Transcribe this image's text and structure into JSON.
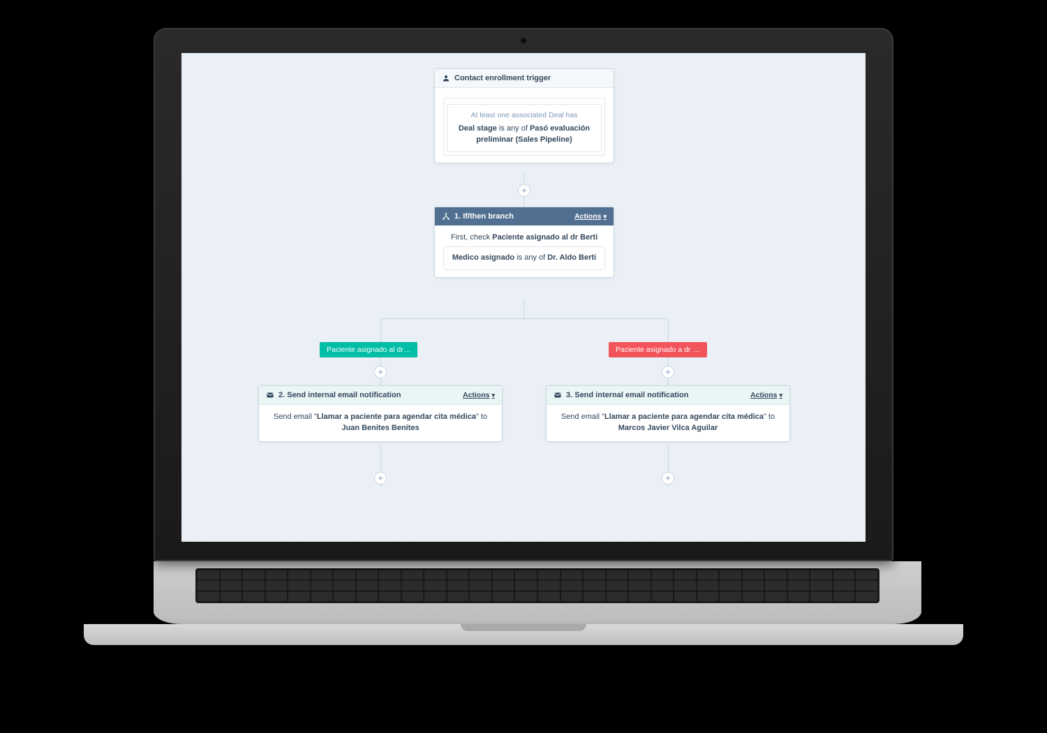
{
  "trigger": {
    "title": "Contact enrollment trigger",
    "hint": "At least one associated Deal has",
    "criteria_prefix": "Deal stage",
    "criteria_mid": " is any of ",
    "criteria_value": "Pasó evaluación preliminar (Sales Pipeline)"
  },
  "branch": {
    "title": "1. If/then branch",
    "actions_label": "Actions",
    "check_prefix": "First, check ",
    "check_target": "Paciente asignado al dr Berti",
    "criteria_prefix": "Medico asignado",
    "criteria_mid": " is any of ",
    "criteria_value": "Dr. Aldo Berti"
  },
  "branches": {
    "left_label": "Paciente asignado al dr…",
    "right_label": "Paciente asignado a dr …"
  },
  "action_left": {
    "title": "2. Send internal email notification",
    "actions_label": "Actions",
    "body_prefix": "Send email \"",
    "email_name": "Llamar a paciente para agendar cita médica",
    "body_mid": "\" to ",
    "recipient": "Juan Benites Benites"
  },
  "action_right": {
    "title": "3. Send internal email notification",
    "actions_label": "Actions",
    "body_prefix": "Send email \"",
    "email_name": "Llamar a paciente para agendar cita médica",
    "body_mid": "\" to ",
    "recipient": "Marcos Javier Vilca Aguilar"
  }
}
